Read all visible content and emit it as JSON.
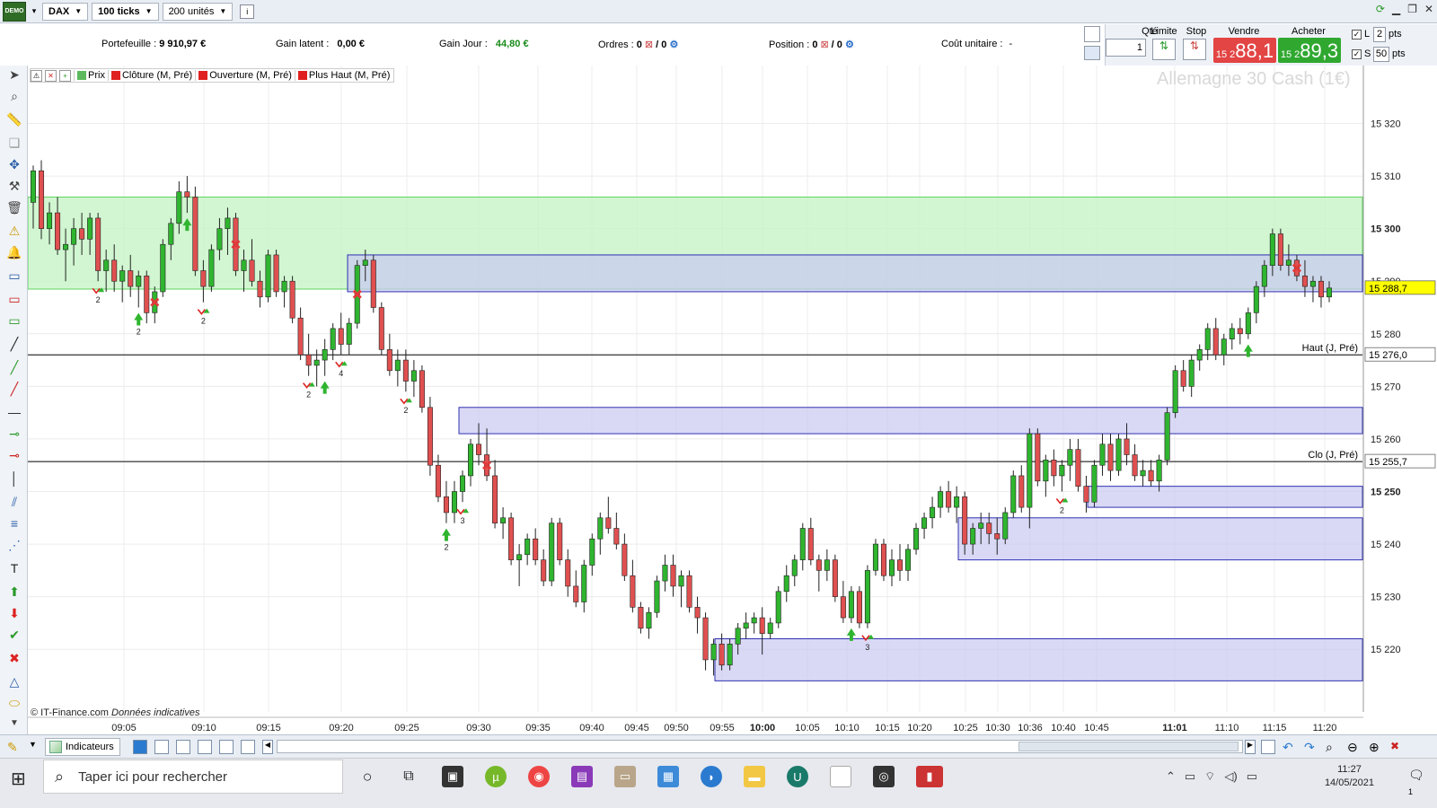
{
  "topbar": {
    "logo_text": "DEMO",
    "instrument": "DAX",
    "timeframe": "100 ticks",
    "units": "200 unités"
  },
  "info": {
    "portfolio_label": "Portefeuille :",
    "portfolio_value": "9 910,97 €",
    "gain_latent_label": "Gain latent :",
    "gain_latent_value": "0,00 €",
    "gain_jour_label": "Gain Jour :",
    "gain_jour_value": "44,80 €",
    "ordres_label": "Ordres :",
    "ordres_a": "0",
    "ordres_b": "/ 0",
    "position_label": "Position :",
    "position_a": "0",
    "position_b": "/ 0",
    "cout_label": "Coût unitaire :",
    "cout_value": "-"
  },
  "order_panel": {
    "qty_label": "Qté",
    "qty_value": "1",
    "limit_label": "Limite",
    "stop_label": "Stop",
    "sell_label": "Vendre",
    "buy_label": "Acheter",
    "sell_small": "15 2",
    "sell_big": "88,1",
    "buy_small": "15 2",
    "buy_big": "89,3",
    "l_label": "L",
    "l_pts": "2",
    "s_label": "S",
    "s_pts": "50",
    "pts": "pts"
  },
  "legend": {
    "prix": "Prix",
    "cloture": "Clôture (M, Pré)",
    "ouverture": "Ouverture (M, Pré)",
    "plus_haut": "Plus Haut (M, Pré)"
  },
  "chart": {
    "watermark": "Allemagne 30 Cash (1€)",
    "copyright": "© IT-Finance.com",
    "copyright_note": "Données indicatives",
    "last_price": "15 288,7",
    "haut_label": "Haut (J, Pré)",
    "haut_price": "15 276,0",
    "clo_label": "Clo (J, Pré)",
    "clo_price": "15 255,7"
  },
  "chart_data": {
    "type": "candlestick",
    "title": "Allemagne 30 Cash (1€)",
    "ylim": [
      15215,
      15320
    ],
    "y_ticks": [
      "15 320",
      "15 310",
      "15 300",
      "15 290",
      "15 280",
      "15 270",
      "15 260",
      "15 250",
      "15 240",
      "15 230",
      "15 220"
    ],
    "x_ticks": [
      "09:05",
      "09:10",
      "09:15",
      "09:20",
      "09:25",
      "09:30",
      "09:35",
      "09:40",
      "09:45",
      "09:50",
      "09:55",
      "10:00",
      "10:05",
      "10:10",
      "10:15",
      "10:20",
      "10:25",
      "10:30",
      "10:36",
      "10:40",
      "10:45",
      "11:01",
      "11:10",
      "11:15",
      "11:20"
    ],
    "bold_x_ticks": [
      "10:00",
      "11:01"
    ],
    "bold_y_ticks": [
      "15 300",
      "15 250"
    ],
    "horizontal_lines": [
      {
        "label": "Haut (J, Pré)",
        "value": 15276.0,
        "color": "#000000"
      },
      {
        "label": "Clo (J, Pré)",
        "value": 15255.7,
        "color": "#000000"
      },
      {
        "label": "last",
        "value": 15288.7,
        "color": "#ffff00"
      }
    ],
    "zones": [
      {
        "color": "green",
        "y_top": 15306,
        "y_bottom": 15288.5,
        "x_start": "09:00",
        "x_end": "end"
      },
      {
        "color": "blue",
        "y_top": 15295,
        "y_bottom": 15288,
        "x_start": "09:20",
        "x_end": "end"
      },
      {
        "color": "blue",
        "y_top": 15266,
        "y_bottom": 15261,
        "x_start": "09:27",
        "x_end": "end"
      },
      {
        "color": "blue",
        "y_top": 15251,
        "y_bottom": 15247,
        "x_start": "10:45",
        "x_end": "end"
      },
      {
        "color": "blue",
        "y_top": 15245,
        "y_bottom": 15237,
        "x_start": "10:25",
        "x_end": "end"
      },
      {
        "color": "blue",
        "y_top": 15222,
        "y_bottom": 15214,
        "x_start": "09:55",
        "x_end": "end"
      }
    ],
    "candles": [
      [
        15305,
        15312,
        15300,
        15311
      ],
      [
        15311,
        15313,
        15298,
        15300
      ],
      [
        15300,
        15305,
        15297,
        15303
      ],
      [
        15303,
        15306,
        15295,
        15296
      ],
      [
        15296,
        15300,
        15290,
        15297
      ],
      [
        15297,
        15302,
        15293,
        15300
      ],
      [
        15300,
        15303,
        15295,
        15298
      ],
      [
        15298,
        15303,
        15295,
        15302
      ],
      [
        15302,
        15303,
        15290,
        15292
      ],
      [
        15292,
        15296,
        15288,
        15294
      ],
      [
        15294,
        15297,
        15288,
        15290
      ],
      [
        15290,
        15293,
        15286,
        15292
      ],
      [
        15292,
        15295,
        15287,
        15289
      ],
      [
        15289,
        15292,
        15285,
        15291
      ],
      [
        15291,
        15292,
        15282,
        15284
      ],
      [
        15284,
        15289,
        15282,
        15288
      ],
      [
        15288,
        15298,
        15287,
        15297
      ],
      [
        15297,
        15302,
        15294,
        15301
      ],
      [
        15301,
        15309,
        15299,
        15307
      ],
      [
        15307,
        15310,
        15303,
        15306
      ],
      [
        15306,
        15308,
        15291,
        15292
      ],
      [
        15292,
        15294,
        15286,
        15289
      ],
      [
        15289,
        15297,
        15288,
        15296
      ],
      [
        15296,
        15302,
        15294,
        15300
      ],
      [
        15300,
        15304,
        15295,
        15302
      ],
      [
        15302,
        15303,
        15291,
        15292
      ],
      [
        15292,
        15296,
        15288,
        15294
      ],
      [
        15294,
        15298,
        15289,
        15290
      ],
      [
        15290,
        15292,
        15285,
        15287
      ],
      [
        15287,
        15296,
        15286,
        15295
      ],
      [
        15295,
        15296,
        15287,
        15288
      ],
      [
        15288,
        15291,
        15285,
        15290
      ],
      [
        15290,
        15291,
        15282,
        15283
      ],
      [
        15283,
        15285,
        15275,
        15276
      ],
      [
        15276,
        15280,
        15272,
        15274
      ],
      [
        15274,
        15277,
        15270,
        15275
      ],
      [
        15275,
        15279,
        15272,
        15277
      ],
      [
        15277,
        15282,
        15275,
        15281
      ],
      [
        15281,
        15284,
        15276,
        15278
      ],
      [
        15278,
        15283,
        15276,
        15282
      ],
      [
        15282,
        15294,
        15281,
        15293
      ],
      [
        15293,
        15296,
        15290,
        15294
      ],
      [
        15294,
        15295,
        15284,
        15285
      ],
      [
        15285,
        15286,
        15276,
        15277
      ],
      [
        15277,
        15280,
        15272,
        15273
      ],
      [
        15273,
        15277,
        15270,
        15275
      ],
      [
        15275,
        15277,
        15269,
        15271
      ],
      [
        15271,
        15275,
        15268,
        15273
      ],
      [
        15273,
        15274,
        15265,
        15266
      ],
      [
        15266,
        15268,
        15253,
        15255
      ],
      [
        15255,
        15257,
        15248,
        15249
      ],
      [
        15249,
        15252,
        15244,
        15246
      ],
      [
        15246,
        15252,
        15244,
        15250
      ],
      [
        15250,
        15254,
        15248,
        15253
      ],
      [
        15253,
        15260,
        15251,
        15259
      ],
      [
        15259,
        15263,
        15255,
        15257
      ],
      [
        15257,
        15262,
        15252,
        15253
      ],
      [
        15253,
        15256,
        15243,
        15244
      ],
      [
        15244,
        15247,
        15241,
        15245
      ],
      [
        15245,
        15246,
        15236,
        15237
      ],
      [
        15237,
        15240,
        15232,
        15238
      ],
      [
        15238,
        15242,
        15236,
        15241
      ],
      [
        15241,
        15243,
        15236,
        15237
      ],
      [
        15237,
        15239,
        15232,
        15233
      ],
      [
        15233,
        15245,
        15232,
        15244
      ],
      [
        15244,
        15245,
        15236,
        15237
      ],
      [
        15237,
        15239,
        15230,
        15232
      ],
      [
        15232,
        15235,
        15228,
        15229
      ],
      [
        15229,
        15237,
        15227,
        15236
      ],
      [
        15236,
        15242,
        15234,
        15241
      ],
      [
        15241,
        15246,
        15238,
        15245
      ],
      [
        15245,
        15249,
        15242,
        15243
      ],
      [
        15243,
        15246,
        15239,
        15240
      ],
      [
        15240,
        15242,
        15233,
        15234
      ],
      [
        15234,
        15237,
        15227,
        15228
      ],
      [
        15228,
        15229,
        15223,
        15224
      ],
      [
        15224,
        15228,
        15222,
        15227
      ],
      [
        15227,
        15234,
        15226,
        15233
      ],
      [
        15233,
        15238,
        15231,
        15236
      ],
      [
        15236,
        15238,
        15230,
        15232
      ],
      [
        15232,
        15235,
        15228,
        15234
      ],
      [
        15234,
        15235,
        15227,
        15228
      ],
      [
        15228,
        15230,
        15223,
        15226
      ],
      [
        15226,
        15227,
        15216,
        15218
      ],
      [
        15218,
        15222,
        15215,
        15221
      ],
      [
        15221,
        15223,
        15216,
        15217
      ],
      [
        15217,
        15222,
        15216,
        15221
      ],
      [
        15221,
        15225,
        15219,
        15224
      ],
      [
        15224,
        15227,
        15222,
        15225
      ],
      [
        15225,
        15227,
        15223,
        15226
      ],
      [
        15226,
        15228,
        15219,
        15223
      ],
      [
        15223,
        15226,
        15222,
        15225
      ],
      [
        15225,
        15232,
        15224,
        15231
      ],
      [
        15231,
        15236,
        15229,
        15234
      ],
      [
        15234,
        15238,
        15232,
        15237
      ],
      [
        15237,
        15244,
        15235,
        15243
      ],
      [
        15243,
        15245,
        15236,
        15237
      ],
      [
        15237,
        15238,
        15231,
        15235
      ],
      [
        15235,
        15239,
        15233,
        15237
      ],
      [
        15237,
        15238,
        15229,
        15230
      ],
      [
        15230,
        15233,
        15225,
        15226
      ],
      [
        15226,
        15232,
        15225,
        15231
      ],
      [
        15231,
        15232,
        15224,
        15225
      ],
      [
        15225,
        15236,
        15224,
        15235
      ],
      [
        15235,
        15241,
        15234,
        15240
      ],
      [
        15240,
        15241,
        15233,
        15234
      ],
      [
        15234,
        15239,
        15232,
        15237
      ],
      [
        15237,
        15240,
        15233,
        15235
      ],
      [
        15235,
        15240,
        15233,
        15239
      ],
      [
        15239,
        15244,
        15238,
        15243
      ],
      [
        15243,
        15246,
        15241,
        15245
      ],
      [
        15245,
        15249,
        15243,
        15247
      ],
      [
        15247,
        15251,
        15245,
        15250
      ],
      [
        15250,
        15252,
        15246,
        15247
      ],
      [
        15247,
        15251,
        15244,
        15249
      ],
      [
        15249,
        15250,
        15238,
        15240
      ],
      [
        15240,
        15244,
        15238,
        15243
      ],
      [
        15243,
        15246,
        15240,
        15244
      ],
      [
        15244,
        15246,
        15240,
        15242
      ],
      [
        15242,
        15245,
        15238,
        15241
      ],
      [
        15241,
        15247,
        15240,
        15246
      ],
      [
        15246,
        15254,
        15245,
        15253
      ],
      [
        15253,
        15255,
        15246,
        15247
      ],
      [
        15247,
        15262,
        15243,
        15261
      ],
      [
        15261,
        15262,
        15251,
        15252
      ],
      [
        15252,
        15257,
        15249,
        15256
      ],
      [
        15256,
        15258,
        15251,
        15253
      ],
      [
        15253,
        15256,
        15250,
        15255
      ],
      [
        15255,
        15260,
        15252,
        15258
      ],
      [
        15258,
        15260,
        15250,
        15251
      ],
      [
        15251,
        15253,
        15246,
        15248
      ],
      [
        15248,
        15256,
        15247,
        15255
      ],
      [
        15255,
        15261,
        15253,
        15259
      ],
      [
        15259,
        15261,
        15252,
        15254
      ],
      [
        15254,
        15261,
        15253,
        15260
      ],
      [
        15260,
        15263,
        15255,
        15257
      ],
      [
        15257,
        15259,
        15252,
        15253
      ],
      [
        15253,
        15256,
        15251,
        15254
      ],
      [
        15254,
        15256,
        15251,
        15252
      ],
      [
        15252,
        15257,
        15250,
        15256
      ],
      [
        15256,
        15266,
        15255,
        15265
      ],
      [
        15265,
        15274,
        15264,
        15273
      ],
      [
        15273,
        15275,
        15269,
        15270
      ],
      [
        15270,
        15276,
        15268,
        15275
      ],
      [
        15275,
        15278,
        15273,
        15277
      ],
      [
        15277,
        15282,
        15275,
        15281
      ],
      [
        15281,
        15283,
        15275,
        15276
      ],
      [
        15276,
        15280,
        15274,
        15279
      ],
      [
        15279,
        15282,
        15277,
        15281
      ],
      [
        15281,
        15283,
        15278,
        15280
      ],
      [
        15280,
        15285,
        15279,
        15284
      ],
      [
        15284,
        15290,
        15282,
        15289
      ],
      [
        15289,
        15294,
        15287,
        15293
      ],
      [
        15293,
        15300,
        15291,
        15299
      ],
      [
        15299,
        15300,
        15292,
        15293
      ],
      [
        15293,
        15297,
        15291,
        15294
      ],
      [
        15294,
        15295,
        15290,
        15291
      ],
      [
        15291,
        15294,
        15287,
        15289
      ],
      [
        15289,
        15291,
        15286,
        15290
      ],
      [
        15290,
        15291,
        15285,
        15287
      ],
      [
        15287,
        15290,
        15286,
        15288.7
      ]
    ],
    "signals": [
      {
        "type": "sell",
        "index": 8,
        "label": "2"
      },
      {
        "type": "buy",
        "index": 13,
        "label": "2"
      },
      {
        "type": "x",
        "index": 15,
        "label": "2"
      },
      {
        "type": "buy",
        "index": 19,
        "label": ""
      },
      {
        "type": "sell",
        "index": 21,
        "label": "2"
      },
      {
        "type": "x",
        "index": 25,
        "label": ""
      },
      {
        "type": "sell",
        "index": 34,
        "label": "2"
      },
      {
        "type": "buy",
        "index": 36,
        "label": ""
      },
      {
        "type": "sell",
        "index": 38,
        "label": "4"
      },
      {
        "type": "x",
        "index": 40,
        "label": ""
      },
      {
        "type": "sell",
        "index": 46,
        "label": "2"
      },
      {
        "type": "buy",
        "index": 51,
        "label": "2"
      },
      {
        "type": "sell",
        "index": 53,
        "label": "3"
      },
      {
        "type": "x",
        "index": 56,
        "label": ""
      },
      {
        "type": "buy",
        "index": 101,
        "label": ""
      },
      {
        "type": "sell",
        "index": 103,
        "label": "3"
      },
      {
        "type": "sell",
        "index": 127,
        "label": "2"
      },
      {
        "type": "buy",
        "index": 150,
        "label": ""
      },
      {
        "type": "x",
        "index": 156,
        "label": ""
      }
    ]
  },
  "bottom": {
    "indicators_label": "Indicateurs"
  },
  "taskbar": {
    "search_placeholder": "Taper ici pour rechercher",
    "time": "11:27",
    "date": "14/05/2021",
    "notif_count": "1"
  },
  "colors": {
    "bull": "#2fb52f",
    "bear": "#e05050",
    "green_zone": "#c9f5c9",
    "blue_zone": "#c9c9f2"
  }
}
